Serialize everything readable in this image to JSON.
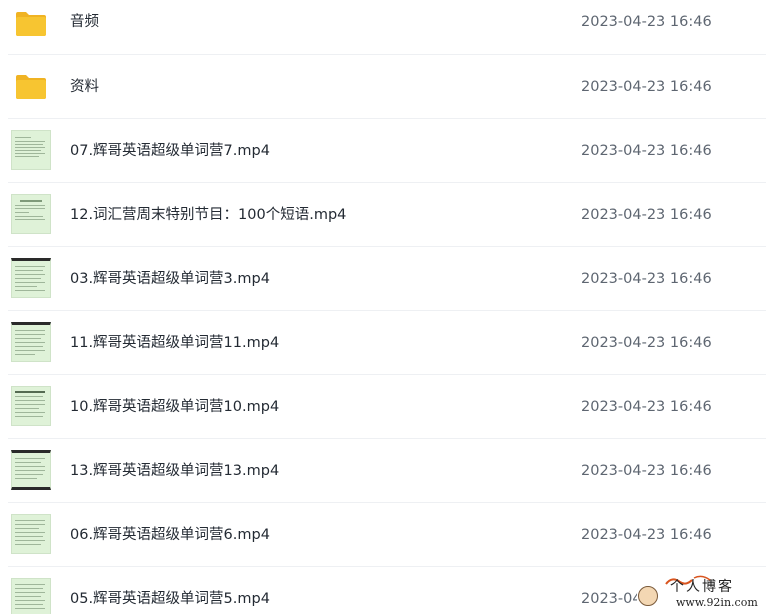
{
  "files": [
    {
      "type": "folder",
      "name": "音频",
      "date": "2023-04-23 16:46"
    },
    {
      "type": "folder",
      "name": "资料",
      "date": "2023-04-23 16:46"
    },
    {
      "type": "video",
      "name": "07.辉哥英语超级单词营7.mp4",
      "date": "2023-04-23 16:46"
    },
    {
      "type": "video",
      "name": "12.词汇营周末特别节目：100个短语.mp4",
      "date": "2023-04-23 16:46"
    },
    {
      "type": "video",
      "name": "03.辉哥英语超级单词营3.mp4",
      "date": "2023-04-23 16:46"
    },
    {
      "type": "video",
      "name": "11.辉哥英语超级单词营11.mp4",
      "date": "2023-04-23 16:46"
    },
    {
      "type": "video",
      "name": "10.辉哥英语超级单词营10.mp4",
      "date": "2023-04-23 16:46"
    },
    {
      "type": "video",
      "name": "13.辉哥英语超级单词营13.mp4",
      "date": "2023-04-23 16:46"
    },
    {
      "type": "video",
      "name": "06.辉哥英语超级单词营6.mp4",
      "date": "2023-04-23 16:46"
    },
    {
      "type": "video",
      "name": "05.辉哥英语超级单词营5.mp4",
      "date": "2023-04-23 16:46"
    }
  ],
  "watermark": {
    "title": "个人博客",
    "url": "www.92in.com"
  },
  "colors": {
    "folder": "#f7c531",
    "folder_back": "#f0b323",
    "thumb_bg": "#dff2d8",
    "separator": "#eef0f3"
  }
}
